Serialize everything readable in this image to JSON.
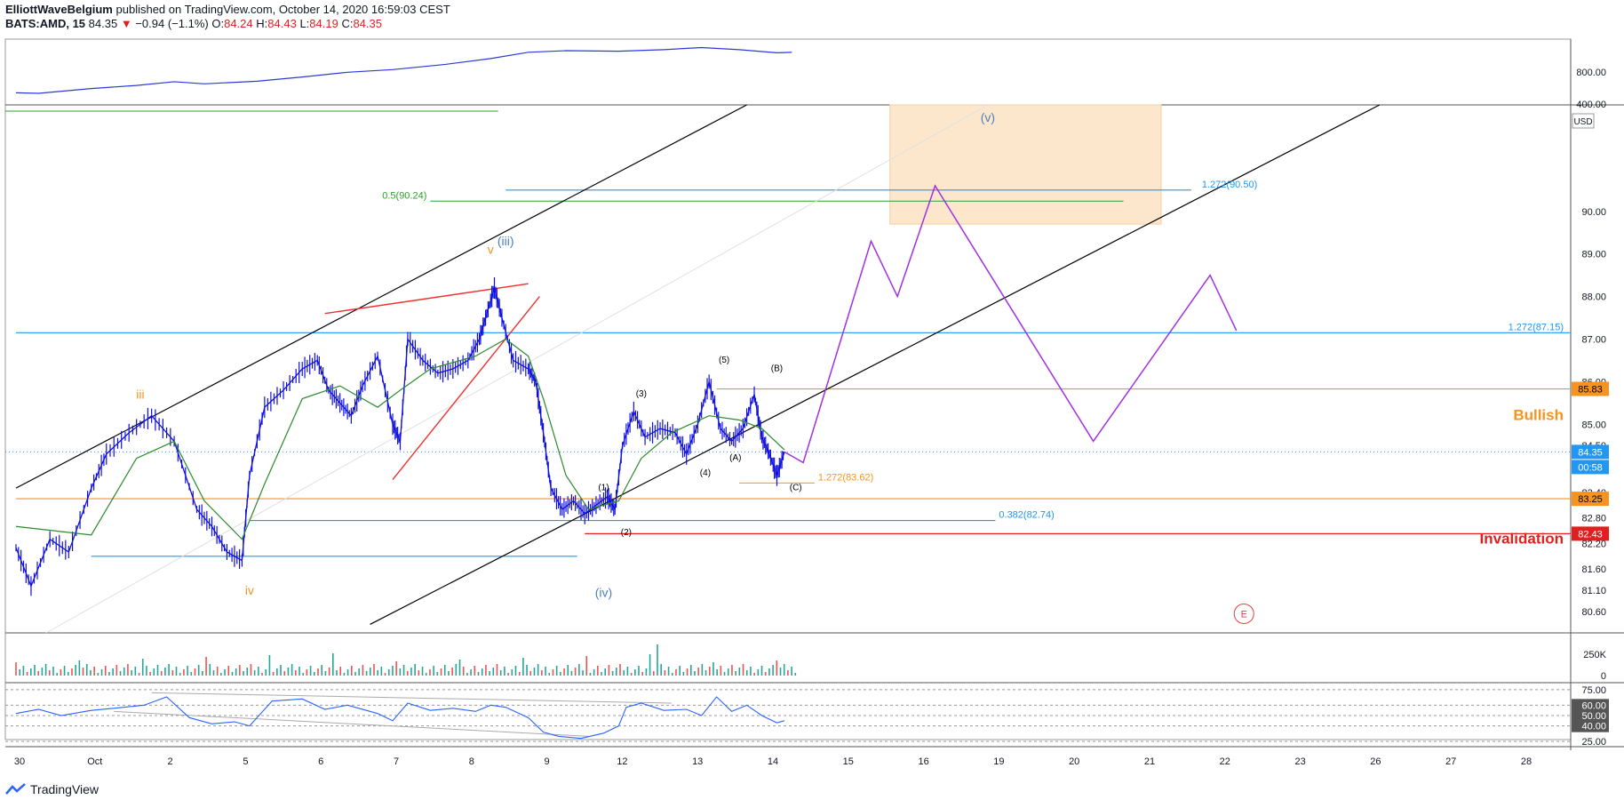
{
  "header": {
    "author": "ElliottWaveBelgium",
    "published": "published on TradingView.com, October 14, 2020 16:59:03 CEST",
    "symbol": "BATS:AMD, 15",
    "last": "84.35",
    "change": "−0.94 (−1.1%)",
    "o_label": "O:",
    "o": "84.24",
    "h_label": "H:",
    "h": "84.43",
    "l_label": "L:",
    "l": "84.19",
    "c_label": "C:",
    "c": "84.35"
  },
  "footer": {
    "brand": "TradingView"
  },
  "colors": {
    "price": "#1010dd",
    "ma": "#2a8a2a",
    "projection": "#a030e0",
    "channel": "#000000",
    "fib_blue": "#2196f3",
    "fib_green": "#2aa02a",
    "support_orange": "#f7931e",
    "invalidation": "#e02020",
    "target_zone": "#fde7cc",
    "wave_orange": "#f7931e",
    "wave_blue": "#4a7fc1"
  },
  "chart_data": [
    {
      "type": "line",
      "panel": "price",
      "series_name": "BATS:AMD, 15",
      "y_axis_ticks": [
        80.6,
        81.1,
        81.6,
        82.2,
        82.8,
        83.4,
        84.0,
        84.5,
        85.0,
        86.0,
        87.0,
        88.0,
        89.0,
        90.0
      ],
      "y_axis_labels": [
        "80.60",
        "81.10",
        "81.60",
        "82.20",
        "82.80",
        "83.40",
        "84.0",
        "84.50",
        "85.00",
        "86.00",
        "87.00",
        "88.00",
        "89.00",
        "90.00"
      ],
      "x_axis_labels": [
        "30",
        "Oct",
        "2",
        "5",
        "6",
        "7",
        "8",
        "9",
        "12",
        "13",
        "14",
        "15",
        "16",
        "19",
        "20",
        "21",
        "22",
        "23",
        "26",
        "27",
        "28"
      ],
      "currency": "USD",
      "price_path": [
        [
          0,
          82.1
        ],
        [
          0.2,
          81.2
        ],
        [
          0.45,
          82.3
        ],
        [
          0.7,
          82.0
        ],
        [
          1.0,
          83.5
        ],
        [
          1.2,
          84.3
        ],
        [
          1.5,
          84.8
        ],
        [
          1.8,
          85.2
        ],
        [
          2.1,
          84.6
        ],
        [
          2.4,
          83.0
        ],
        [
          2.6,
          82.6
        ],
        [
          2.8,
          82.0
        ],
        [
          3.0,
          81.8
        ],
        [
          3.1,
          83.8
        ],
        [
          3.3,
          85.4
        ],
        [
          3.55,
          85.8
        ],
        [
          3.8,
          86.3
        ],
        [
          4.0,
          86.5
        ],
        [
          4.15,
          85.8
        ],
        [
          4.3,
          85.5
        ],
        [
          4.45,
          85.2
        ],
        [
          4.6,
          85.9
        ],
        [
          4.8,
          86.6
        ],
        [
          5.0,
          85.0
        ],
        [
          5.1,
          84.6
        ],
        [
          5.2,
          87.0
        ],
        [
          5.4,
          86.5
        ],
        [
          5.6,
          86.2
        ],
        [
          5.8,
          86.3
        ],
        [
          6.0,
          86.5
        ],
        [
          6.15,
          87.0
        ],
        [
          6.25,
          87.6
        ],
        [
          6.35,
          88.2
        ],
        [
          6.45,
          87.5
        ],
        [
          6.6,
          86.5
        ],
        [
          6.8,
          86.3
        ],
        [
          6.9,
          86.0
        ],
        [
          7.0,
          84.8
        ],
        [
          7.1,
          83.5
        ],
        [
          7.25,
          83.0
        ],
        [
          7.4,
          83.2
        ],
        [
          7.55,
          82.9
        ],
        [
          7.7,
          83.1
        ],
        [
          7.85,
          83.3
        ],
        [
          7.95,
          83.0
        ],
        [
          8.05,
          84.5
        ],
        [
          8.2,
          85.3
        ],
        [
          8.35,
          84.7
        ],
        [
          8.55,
          84.9
        ],
        [
          8.75,
          84.8
        ],
        [
          8.9,
          84.3
        ],
        [
          9.05,
          85.0
        ],
        [
          9.2,
          86.0
        ],
        [
          9.35,
          84.9
        ],
        [
          9.5,
          84.6
        ],
        [
          9.65,
          84.9
        ],
        [
          9.8,
          85.7
        ],
        [
          9.9,
          84.7
        ],
        [
          10.0,
          84.3
        ],
        [
          10.1,
          83.8
        ],
        [
          10.2,
          84.35
        ]
      ],
      "ma_path": [
        [
          0,
          82.6
        ],
        [
          1.0,
          82.4
        ],
        [
          1.6,
          84.2
        ],
        [
          2.1,
          84.6
        ],
        [
          2.5,
          83.2
        ],
        [
          3.0,
          82.3
        ],
        [
          3.3,
          83.6
        ],
        [
          3.8,
          85.6
        ],
        [
          4.3,
          85.9
        ],
        [
          4.8,
          85.4
        ],
        [
          5.1,
          85.8
        ],
        [
          5.5,
          86.3
        ],
        [
          6.1,
          86.6
        ],
        [
          6.5,
          87.0
        ],
        [
          6.8,
          86.6
        ],
        [
          7.0,
          85.6
        ],
        [
          7.3,
          83.8
        ],
        [
          7.6,
          83.0
        ],
        [
          8.0,
          83.2
        ],
        [
          8.3,
          84.2
        ],
        [
          8.7,
          84.8
        ],
        [
          9.2,
          85.2
        ],
        [
          9.6,
          85.1
        ],
        [
          9.9,
          84.9
        ],
        [
          10.2,
          84.4
        ]
      ],
      "projection_path": [
        [
          10.2,
          84.35
        ],
        [
          10.45,
          84.1
        ],
        [
          11.35,
          89.3
        ],
        [
          11.7,
          88.0
        ],
        [
          12.2,
          90.6
        ],
        [
          14.3,
          84.6
        ],
        [
          15.85,
          88.5
        ],
        [
          16.2,
          87.2
        ]
      ],
      "channel_upper": [
        [
          0,
          83.5
        ],
        [
          9.7,
          92.5
        ]
      ],
      "channel_lower": [
        [
          4.7,
          80.3
        ],
        [
          18.1,
          92.5
        ]
      ],
      "trendline_red_upper": [
        [
          4.1,
          87.6
        ],
        [
          6.8,
          88.3
        ]
      ],
      "trendline_red_lower": [
        [
          5.0,
          83.7
        ],
        [
          6.95,
          88.0
        ]
      ],
      "horizontal_levels": [
        {
          "price": 87.15,
          "label": "1.272(87.15)",
          "kind": "fib_blue",
          "from": 0,
          "to": 21
        },
        {
          "price": 90.5,
          "label": "1.272(90.50)",
          "kind": "fib_blue",
          "from": 6.5,
          "to": 15.6
        },
        {
          "price": 90.24,
          "label": "0.5(90.24)",
          "kind": "fib_green",
          "from": 5.5,
          "to": 14.7
        },
        {
          "price": 82.74,
          "label": "0.382(82.74)",
          "kind": "fib_blue",
          "from": 3.1,
          "to": 13.0
        },
        {
          "price": 83.62,
          "label": "1.272(83.62)",
          "kind": "support_orange",
          "from": 9.6,
          "to": 10.6
        },
        {
          "price": 85.83,
          "label": "85.83",
          "kind": "support_orange",
          "from": 9.3,
          "to": 21
        },
        {
          "price": 83.25,
          "label": "83.25",
          "kind": "support_orange",
          "from": 0,
          "to": 21
        },
        {
          "price": 82.43,
          "label": "82.43",
          "kind": "invalidation",
          "from": 7.55,
          "to": 21
        },
        {
          "price": 81.9,
          "label": "",
          "kind": "fib_blue",
          "from": 1.0,
          "to": 7.45
        }
      ],
      "current_price": {
        "price": 84.35,
        "label": "84.35",
        "countdown": "00:58"
      },
      "target_zone": {
        "from": 11.6,
        "to": 15.2,
        "low": 89.7,
        "high": 92.5
      },
      "wave_labels": [
        {
          "text": "iii",
          "x": 1.65,
          "price": 85.6,
          "style": "orange"
        },
        {
          "text": "iv",
          "x": 3.1,
          "price": 81.0,
          "style": "orange"
        },
        {
          "text": "v",
          "x": 6.3,
          "price": 89.0,
          "style": "orange"
        },
        {
          "text": "(iii)",
          "x": 6.5,
          "price": 89.2,
          "style": "blue"
        },
        {
          "text": "(iv)",
          "x": 7.8,
          "price": 80.95,
          "style": "blue"
        },
        {
          "text": "(v)",
          "x": 12.9,
          "price": 92.1,
          "style": "blue"
        },
        {
          "text": "(1)",
          "x": 7.8,
          "price": 83.45,
          "style": "black"
        },
        {
          "text": "(2)",
          "x": 8.1,
          "price": 82.4,
          "style": "black"
        },
        {
          "text": "(3)",
          "x": 8.3,
          "price": 85.65,
          "style": "black"
        },
        {
          "text": "(4)",
          "x": 9.15,
          "price": 83.8,
          "style": "black"
        },
        {
          "text": "(5)",
          "x": 9.4,
          "price": 86.45,
          "style": "black"
        },
        {
          "text": "(A)",
          "x": 9.55,
          "price": 84.15,
          "style": "black"
        },
        {
          "text": "(B)",
          "x": 10.1,
          "price": 86.25,
          "style": "black"
        },
        {
          "text": "(C)",
          "x": 10.35,
          "price": 83.45,
          "style": "black"
        }
      ],
      "annotations": {
        "bullish": "Bullish",
        "invalidation": "Invalidation",
        "e_marker": "E"
      }
    },
    {
      "type": "line",
      "panel": "top_indicator",
      "y_axis_labels": [
        "800.00",
        "400.00"
      ],
      "values_x": [
        0,
        0.3,
        1.0,
        1.6,
        2.1,
        2.5,
        3.2,
        3.8,
        4.4,
        5.0,
        5.7,
        6.3,
        6.8,
        7.3,
        8.0,
        8.6,
        9.1,
        9.6,
        10.1,
        10.3
      ],
      "values": [
        480,
        470,
        560,
        620,
        690,
        650,
        700,
        780,
        870,
        920,
        1020,
        1130,
        1250,
        1280,
        1270,
        1300,
        1340,
        1300,
        1240,
        1250
      ],
      "ylim": [
        250,
        1500
      ]
    },
    {
      "type": "bar",
      "panel": "volume",
      "y_axis_labels": [
        "250K",
        "0"
      ],
      "ylim": [
        0,
        300000
      ],
      "note": "volume histogram"
    },
    {
      "type": "line",
      "panel": "oscillator",
      "y_axis_labels": [
        "75.00",
        "60.00",
        "50.00",
        "40.00",
        "25.00"
      ],
      "ylim": [
        20,
        80
      ],
      "values_x": [
        0,
        0.3,
        0.6,
        1.0,
        1.3,
        1.7,
        2.0,
        2.3,
        2.6,
        2.9,
        3.1,
        3.4,
        3.8,
        4.1,
        4.4,
        4.8,
        5.0,
        5.2,
        5.5,
        5.8,
        6.1,
        6.3,
        6.5,
        6.8,
        7.0,
        7.2,
        7.5,
        7.8,
        8.0,
        8.1,
        8.3,
        8.6,
        8.9,
        9.1,
        9.3,
        9.5,
        9.7,
        9.9,
        10.1,
        10.2
      ],
      "values": [
        52,
        56,
        50,
        55,
        57,
        60,
        68,
        48,
        42,
        44,
        40,
        64,
        66,
        56,
        60,
        52,
        45,
        62,
        55,
        57,
        54,
        60,
        58,
        48,
        34,
        30,
        28,
        33,
        40,
        58,
        62,
        55,
        56,
        50,
        68,
        54,
        60,
        50,
        43,
        45
      ]
    }
  ]
}
